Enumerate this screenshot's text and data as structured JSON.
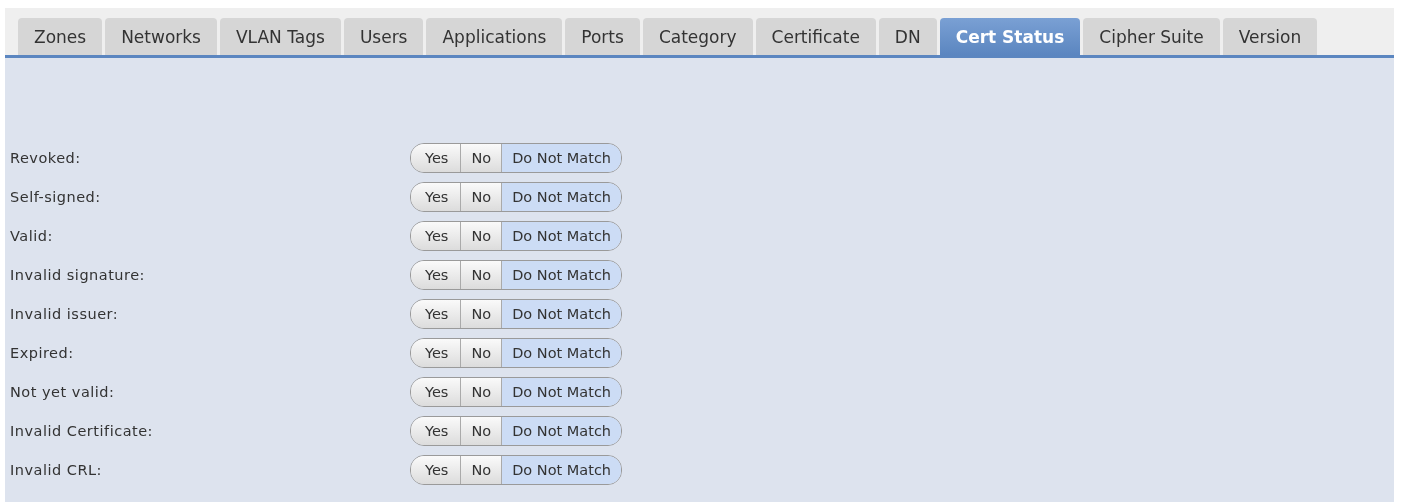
{
  "tabs": [
    {
      "label": "Zones",
      "selected": false
    },
    {
      "label": "Networks",
      "selected": false
    },
    {
      "label": "VLAN Tags",
      "selected": false
    },
    {
      "label": "Users",
      "selected": false
    },
    {
      "label": "Applications",
      "selected": false
    },
    {
      "label": "Ports",
      "selected": false
    },
    {
      "label": "Category",
      "selected": false
    },
    {
      "label": "Certificate",
      "selected": false
    },
    {
      "label": "DN",
      "selected": false
    },
    {
      "label": "Cert Status",
      "selected": true
    },
    {
      "label": "Cipher Suite",
      "selected": false
    },
    {
      "label": "Version",
      "selected": false
    }
  ],
  "rows": [
    {
      "label": "Revoked:",
      "options": [
        {
          "label": "Yes",
          "selected": false
        },
        {
          "label": "No",
          "selected": false
        },
        {
          "label": "Do Not Match",
          "selected": true
        }
      ]
    },
    {
      "label": "Self-signed:",
      "options": [
        {
          "label": "Yes",
          "selected": false
        },
        {
          "label": "No",
          "selected": false
        },
        {
          "label": "Do Not Match",
          "selected": true
        }
      ]
    },
    {
      "label": "Valid:",
      "options": [
        {
          "label": "Yes",
          "selected": false
        },
        {
          "label": "No",
          "selected": false
        },
        {
          "label": "Do Not Match",
          "selected": true
        }
      ]
    },
    {
      "label": "Invalid signature:",
      "options": [
        {
          "label": "Yes",
          "selected": false
        },
        {
          "label": "No",
          "selected": false
        },
        {
          "label": "Do Not Match",
          "selected": true
        }
      ]
    },
    {
      "label": "Invalid issuer:",
      "options": [
        {
          "label": "Yes",
          "selected": false
        },
        {
          "label": "No",
          "selected": false
        },
        {
          "label": "Do Not Match",
          "selected": true
        }
      ]
    },
    {
      "label": "Expired:",
      "options": [
        {
          "label": "Yes",
          "selected": false
        },
        {
          "label": "No",
          "selected": false
        },
        {
          "label": "Do Not Match",
          "selected": true
        }
      ]
    },
    {
      "label": "Not yet valid:",
      "options": [
        {
          "label": "Yes",
          "selected": false
        },
        {
          "label": "No",
          "selected": false
        },
        {
          "label": "Do Not Match",
          "selected": true
        }
      ]
    },
    {
      "label": "Invalid Certificate:",
      "options": [
        {
          "label": "Yes",
          "selected": false
        },
        {
          "label": "No",
          "selected": false
        },
        {
          "label": "Do Not Match",
          "selected": true
        }
      ]
    },
    {
      "label": "Invalid CRL:",
      "options": [
        {
          "label": "Yes",
          "selected": false
        },
        {
          "label": "No",
          "selected": false
        },
        {
          "label": "Do Not Match",
          "selected": true
        }
      ]
    }
  ]
}
